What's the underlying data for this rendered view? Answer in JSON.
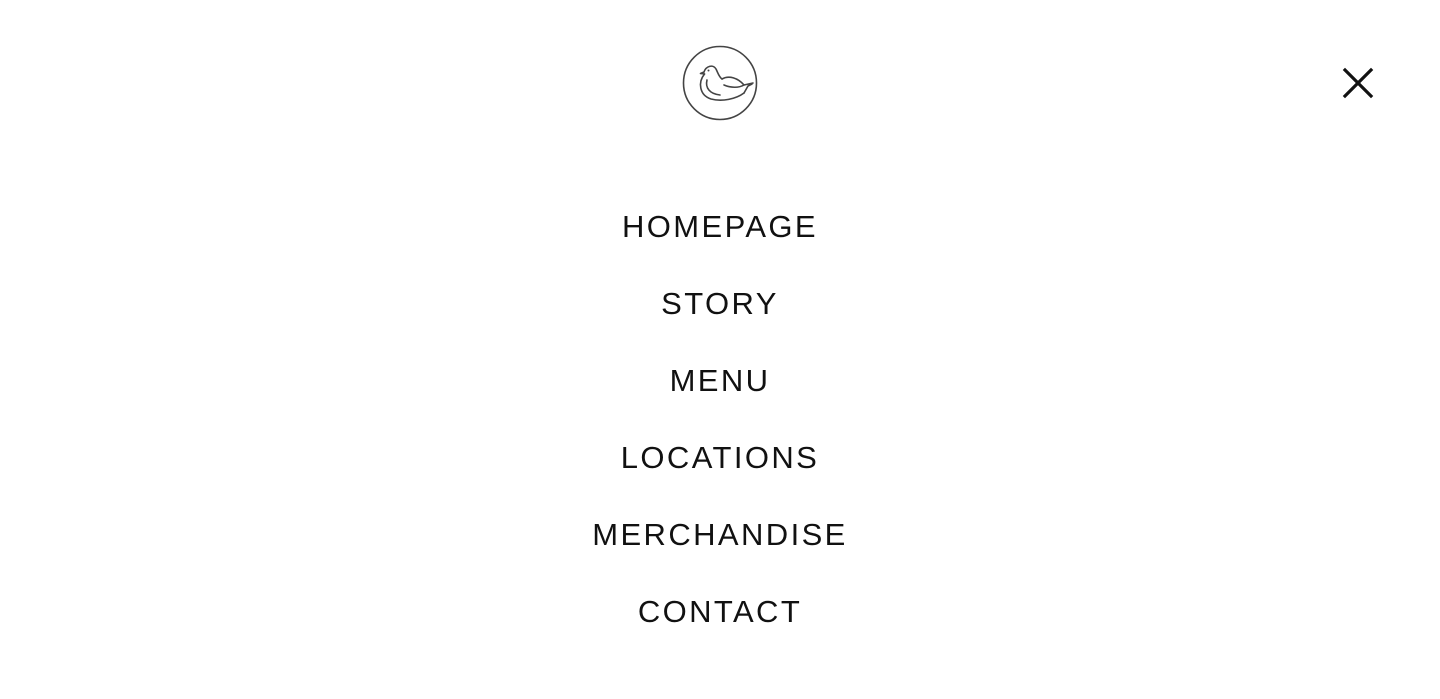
{
  "header": {
    "logo_icon": "bird-in-circle-logo-icon",
    "close_icon": "close-icon",
    "close_label": "Close menu"
  },
  "nav": {
    "items": [
      {
        "label": "HOMEPAGE"
      },
      {
        "label": "STORY"
      },
      {
        "label": "MENU"
      },
      {
        "label": "LOCATIONS"
      },
      {
        "label": "MERCHANDISE"
      },
      {
        "label": "CONTACT"
      }
    ]
  },
  "colors": {
    "background": "#ffffff",
    "text": "#111111",
    "logo_stroke": "#444444"
  }
}
